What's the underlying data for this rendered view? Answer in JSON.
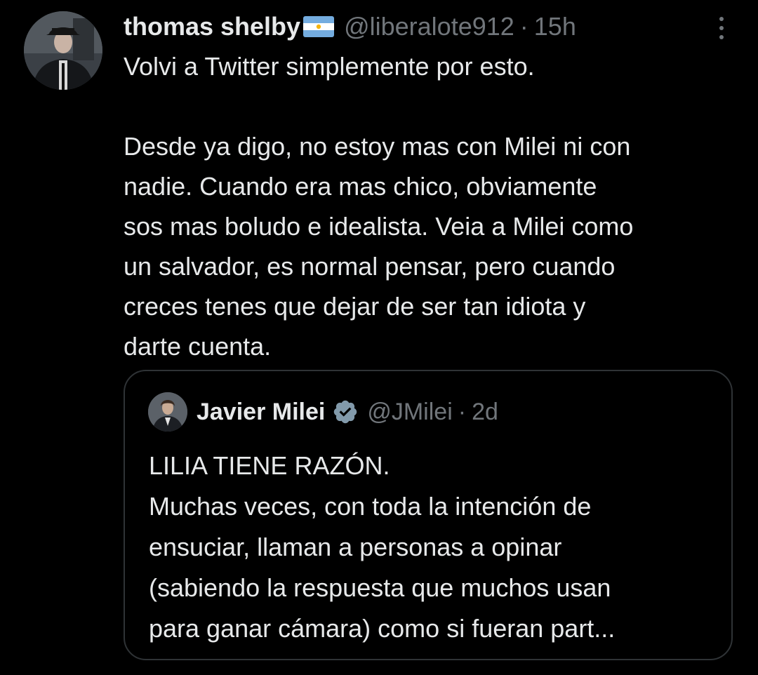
{
  "tweet": {
    "author": {
      "display_name": "thomas shelby",
      "flag_icon": "argentina-flag-icon",
      "handle": "@liberalote912",
      "separator": "·",
      "time": "15h"
    },
    "more_icon": "more-vertical-icon",
    "lines": [
      "Volvi a Twitter simplemente por esto.",
      "",
      "Desde ya digo, no estoy mas con Milei ni con",
      "nadie. Cuando era mas chico, obviamente",
      "sos mas boludo e idealista. Veia a Milei como",
      "un salvador, es normal pensar, pero cuando",
      "creces tenes que dejar de ser tan idiota y",
      "darte cuenta."
    ]
  },
  "quoted_tweet": {
    "author": {
      "display_name": "Javier Milei",
      "verified_icon": "verified-badge-icon",
      "handle": "@JMilei",
      "separator": "·",
      "time": "2d"
    },
    "lines": [
      "LILIA TIENE RAZÓN.",
      "Muchas veces, con toda la intención de",
      "ensuciar, llaman a personas a opinar",
      "(sabiendo la respuesta que muchos usan",
      "para ganar cámara) como si fueran part..."
    ]
  },
  "colors": {
    "background": "#000000",
    "primary_text": "#e7e9ea",
    "secondary_text": "#71767b",
    "border": "#2f3336",
    "verified_badge": "#829aab"
  }
}
